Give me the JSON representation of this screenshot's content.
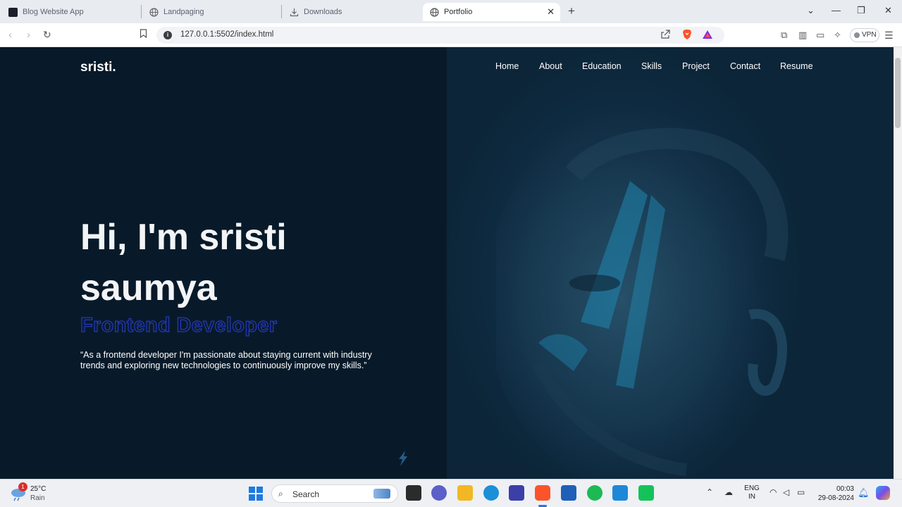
{
  "browser": {
    "tabs": [
      {
        "label": "Blog Website App",
        "active": false
      },
      {
        "label": "Landpaging",
        "active": false
      },
      {
        "label": "Downloads",
        "active": false
      },
      {
        "label": "Portfolio",
        "active": true
      }
    ],
    "url": "127.0.0.1:5502/index.html",
    "vpn_label": "VPN"
  },
  "site": {
    "logo": "sristi.",
    "nav": [
      "Home",
      "About",
      "Education",
      "Skills",
      "Project",
      "Contact",
      "Resume"
    ],
    "hero": {
      "line1": "Hi, I'm sristi",
      "line2": "saumya",
      "role": "Frontend Developer",
      "quote": "“As a frontend developer I'm passionate about staying current with industry trends and exploring new technologies to continuously improve my skills.”"
    }
  },
  "taskbar": {
    "weather_temp": "25°C",
    "weather_cond": "Rain",
    "weather_badge": "1",
    "search_label": "Search",
    "lang_top": "ENG",
    "lang_bottom": "IN",
    "time": "00:03",
    "date": "29-08-2024"
  },
  "colors": {
    "page_bg": "#081a29",
    "accent_role": "#2a3fd0",
    "hero_text": "#f2f4f6"
  }
}
